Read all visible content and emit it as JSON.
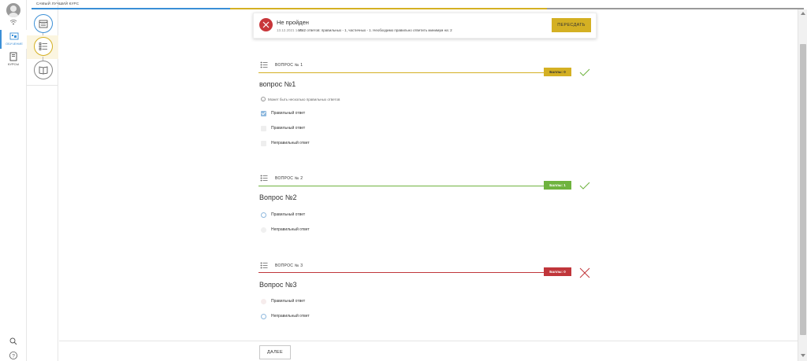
{
  "breadcrumb": "САМЫЙ ЛУЧШИЙ КУРС",
  "sidebar": {
    "items": [
      {
        "label": "ОБУЧЕНИЕ"
      },
      {
        "label": "КУРСЫ"
      }
    ]
  },
  "result": {
    "title": "Не пройден",
    "date": "13.12.2021 14:56",
    "description": "Из 2 ответов: правильных - 1, частичных - 1. Необходимо правильно ответить минимум на: 2",
    "retry_label": "ПЕРЕСДАТЬ"
  },
  "questions": [
    {
      "label": "ВОПРОС № 1",
      "title": "вопрос №1",
      "score": "Баллы: 0",
      "verdict": "check",
      "hint": "Может быть несколько правильных ответов",
      "answers": [
        {
          "text": "Правильный ответ",
          "checked": true
        },
        {
          "text": "Правильный ответ",
          "checked": false
        },
        {
          "text": "Неправильный ответ",
          "checked": false
        }
      ]
    },
    {
      "label": "ВОПРОС № 2",
      "title": "Вопрос №2",
      "score": "Баллы: 1",
      "verdict": "check",
      "answers": [
        {
          "text": "Правильный ответ",
          "selected": true
        },
        {
          "text": "Неправильный ответ",
          "selected": false
        }
      ]
    },
    {
      "label": "ВОПРОС № 3",
      "title": "Вопрос №3",
      "score": "Баллы: 0",
      "verdict": "cross",
      "answers": [
        {
          "text": "Правильный ответ",
          "selected": false
        },
        {
          "text": "Неправильный ответ",
          "selected": true
        }
      ]
    }
  ],
  "next_label": "ДАЛЕЕ",
  "colors": {
    "accent_yellow": "#d4b023",
    "success_green": "#6fb33f",
    "error_red": "#c0363b",
    "blue": "#3b8fd6"
  }
}
